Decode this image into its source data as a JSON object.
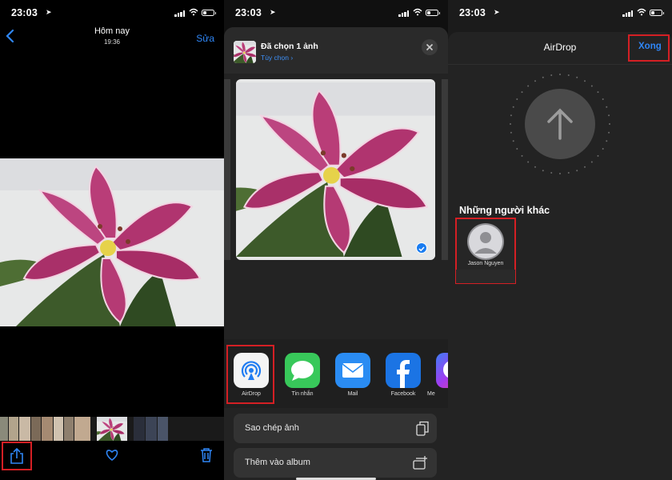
{
  "status_bar": {
    "time": "23:03"
  },
  "photos_view": {
    "title": "Hôm nay",
    "subtitle": "19:36",
    "edit_label": "Sửa"
  },
  "share_sheet": {
    "title": "Đã chọn 1 ảnh",
    "options_label": "Tùy chọn",
    "apps": [
      {
        "label": "AirDrop"
      },
      {
        "label": "Tin nhắn"
      },
      {
        "label": "Mail"
      },
      {
        "label": "Facebook"
      },
      {
        "label": "Me"
      }
    ],
    "actions": [
      {
        "label": "Sao chép ảnh"
      },
      {
        "label": "Thêm vào album"
      }
    ]
  },
  "airdrop_view": {
    "title": "AirDrop",
    "done_label": "Xong",
    "others_heading": "Những người khác",
    "person_name": "Jason Nguyen"
  },
  "colors": {
    "accent_blue": "#2f86f6",
    "highlight_red": "#d41f24",
    "flower_pink": "#b23a72"
  }
}
